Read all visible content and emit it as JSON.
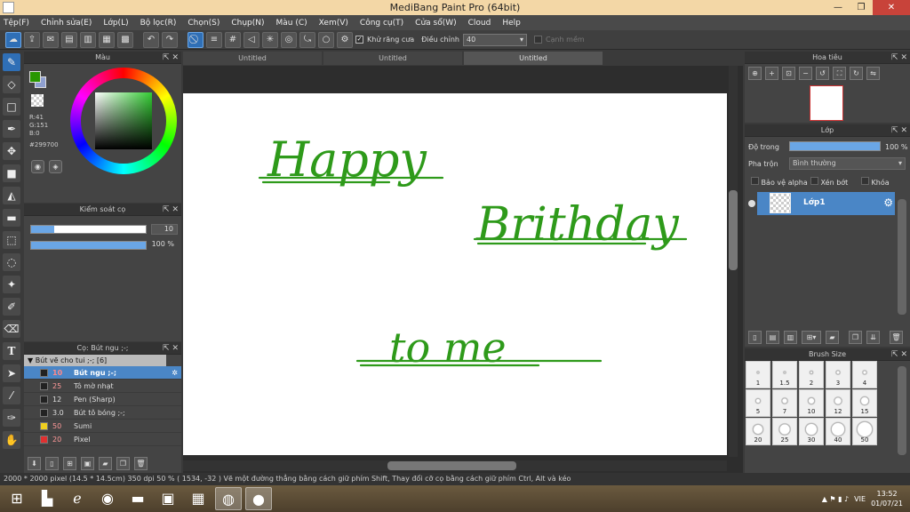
{
  "window": {
    "title": "MediBang Paint Pro (64bit)",
    "minimize": "—",
    "maximize": "❐",
    "close": "✕"
  },
  "menu": [
    "Tệp(F)",
    "Chỉnh sửa(E)",
    "Lớp(L)",
    "Bộ lọc(R)",
    "Chọn(S)",
    "Chụp(N)",
    "Màu (C)",
    "Xem(V)",
    "Công cụ(T)",
    "Cửa sổ(W)",
    "Cloud",
    "Help"
  ],
  "toolbar": {
    "antialias_label": "Khử răng cưa",
    "adjust_label": "Điều chỉnh",
    "brush_size_value": "40",
    "smooth_label": "Cạnh mềm"
  },
  "tabs": [
    "Untitled",
    "Untitled",
    "Untitled"
  ],
  "color_panel": {
    "title": "Màu",
    "r": "R:41",
    "g": "G:151",
    "b": "B:0",
    "hex": "#299700",
    "fg_color": "#299700"
  },
  "brush_control": {
    "title": "Kiểm soát cọ",
    "size_value": "10",
    "opacity_value": "100 %",
    "size_fraction": 0.2,
    "opacity_fraction": 1.0
  },
  "brush_panel": {
    "title": "Cọ: Bút ngu ;-;",
    "group": "Bút vẽ cho tui ;-; [6]",
    "items": [
      {
        "size": "10",
        "name": "Bút ngu ;-;",
        "color": "#222222",
        "selected": true
      },
      {
        "size": "25",
        "name": "Tô mờ nhạt",
        "color": "#222222",
        "selected": false
      },
      {
        "size": "12",
        "name": "Pen (Sharp)",
        "color": "#222222",
        "selected": false
      },
      {
        "size": "3.0",
        "name": "Bút tô bóng ;-;",
        "color": "#222222",
        "selected": false
      },
      {
        "size": "50",
        "name": "Sumi",
        "color": "#f0d020",
        "selected": false
      },
      {
        "size": "20",
        "name": "Pixel",
        "color": "#e03030",
        "selected": false
      }
    ]
  },
  "navigator": {
    "title": "Hoa tiêu"
  },
  "layers": {
    "title": "Lớp",
    "opacity_label": "Độ trong",
    "opacity_value": "100 %",
    "blend_label": "Pha trộn",
    "blend_value": "Bình thường",
    "protect_alpha": "Bảo vệ alpha",
    "clipping": "Xén bớt",
    "lock": "Khóa",
    "layer_name": "Lớp1"
  },
  "brush_size": {
    "title": "Brush Size",
    "sizes": [
      "1",
      "1.5",
      "2",
      "3",
      "4",
      "5",
      "7",
      "10",
      "12",
      "15",
      "20",
      "25",
      "30",
      "40",
      "50"
    ]
  },
  "canvas": {
    "ink_color": "#2e9a1a",
    "text1": "Happy",
    "text2": "Brithday",
    "text3": "to me"
  },
  "status": {
    "text": "2000 * 2000 pixel   (14.5 * 14.5cm)   350 dpi   50 %   ( 1534, -32 )   Vẽ một đường thẳng bằng cách giữ phím Shift, Thay đổi cỡ cọ bằng cách giữ phím Ctrl, Alt và kéo"
  },
  "taskbar": {
    "language": "VIE",
    "time": "13:52",
    "date": "01/07/21"
  }
}
